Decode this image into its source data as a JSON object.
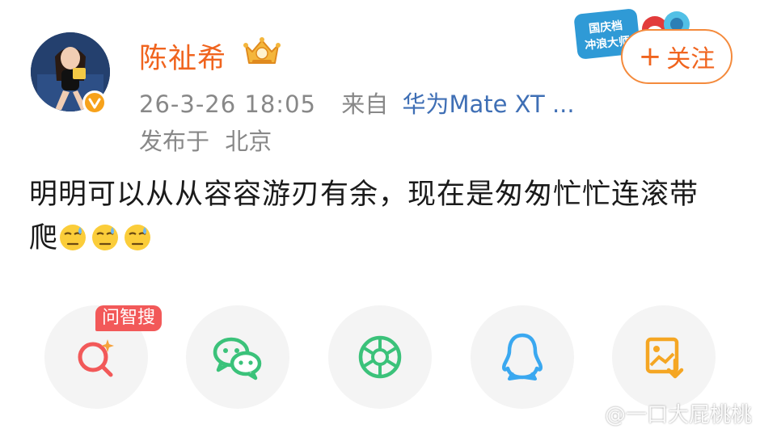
{
  "post": {
    "author": {
      "name": "陈祉希",
      "badge_icon": "crown-medal-icon",
      "verified_icon": "verified-v-icon"
    },
    "timestamp": "26-3-26 18:05",
    "source_prefix": "来自",
    "source_device": "华为Mate XT ...",
    "location_prefix": "发布于",
    "location": "北京",
    "content": "明明可以从从容容游刃有余，现在是匆匆忙忙连滚带爬",
    "emojis": [
      "sweat-face-emoji",
      "sweat-face-emoji",
      "sweat-face-emoji"
    ]
  },
  "follow_button": {
    "plus": "+",
    "label": "关注"
  },
  "promo_sticker": {
    "line1": "国庆档",
    "line2": "冲浪大师"
  },
  "share": {
    "ai_badge": "问智搜",
    "buttons": [
      {
        "icon": "ai-search-icon"
      },
      {
        "icon": "wechat-icon"
      },
      {
        "icon": "moments-icon"
      },
      {
        "icon": "qq-icon"
      },
      {
        "icon": "save-image-icon"
      }
    ]
  },
  "watermark": {
    "text": "@一口大屁桃桃"
  },
  "colors": {
    "accent": "#f0641e",
    "link": "#3f6fb5",
    "meta": "#888888",
    "wechat": "#3bc27a",
    "qq": "#3aa8f0",
    "save": "#f5a623",
    "ai_red": "#f25959"
  }
}
